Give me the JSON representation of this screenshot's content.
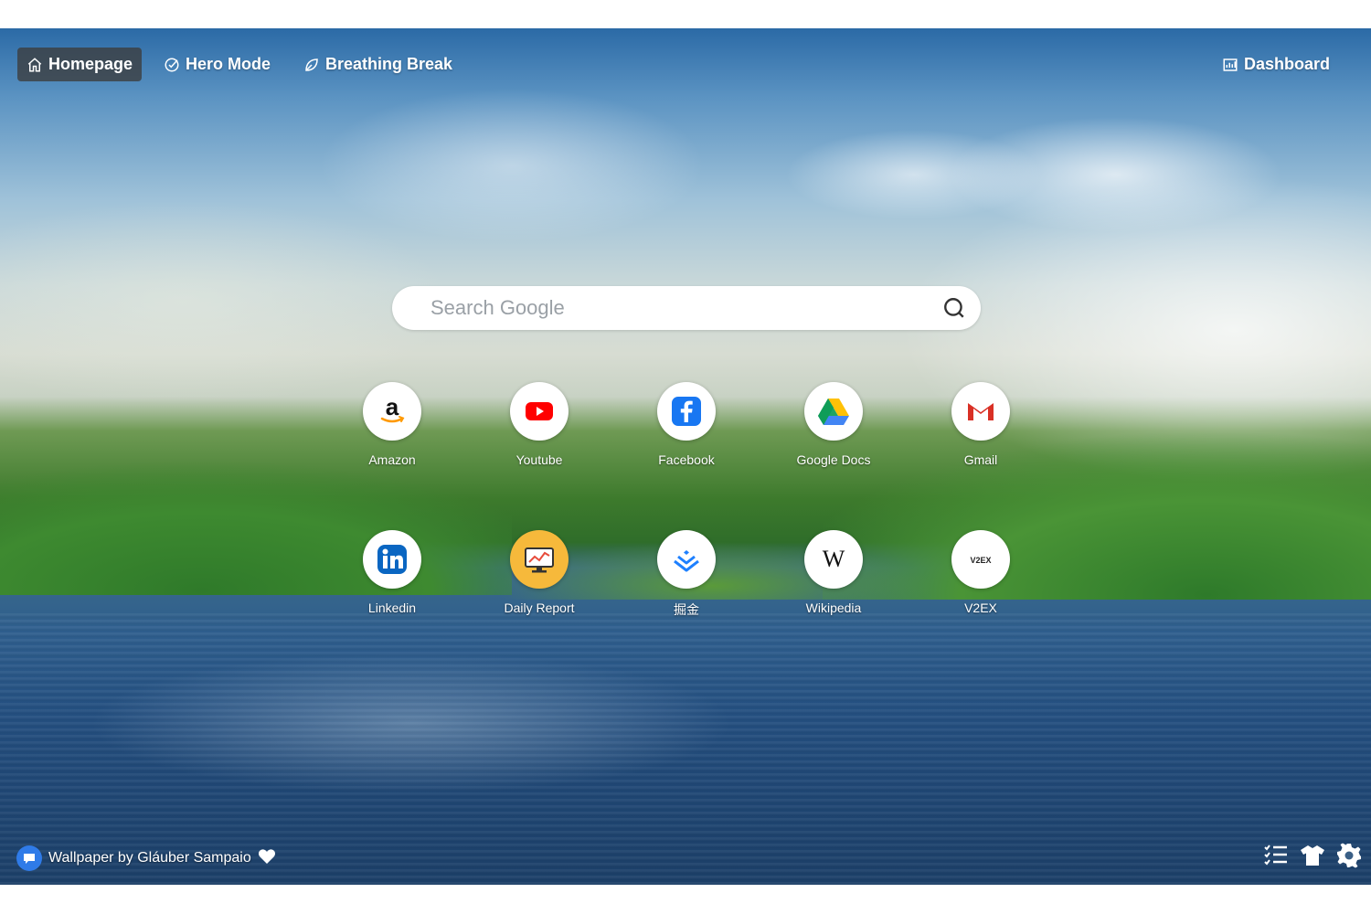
{
  "nav": {
    "left": [
      {
        "label": "Homepage",
        "icon": "home-icon",
        "active": true
      },
      {
        "label": "Hero Mode",
        "icon": "compass-check-icon",
        "active": false
      },
      {
        "label": "Breathing Break",
        "icon": "leaf-icon",
        "active": false
      }
    ],
    "right": {
      "label": "Dashboard",
      "icon": "bar-chart-icon"
    }
  },
  "search": {
    "placeholder": "Search Google",
    "value": ""
  },
  "shortcuts": [
    {
      "label": "Amazon",
      "icon": "amazon-icon"
    },
    {
      "label": "Youtube",
      "icon": "youtube-icon"
    },
    {
      "label": "Facebook",
      "icon": "facebook-icon"
    },
    {
      "label": "Google Docs",
      "icon": "google-drive-icon"
    },
    {
      "label": "Gmail",
      "icon": "gmail-icon"
    },
    {
      "label": "Linkedin",
      "icon": "linkedin-icon"
    },
    {
      "label": "Daily Report",
      "icon": "monitor-chart-icon"
    },
    {
      "label": "掘金",
      "icon": "juejin-icon"
    },
    {
      "label": "Wikipedia",
      "icon": "wikipedia-icon"
    },
    {
      "label": "V2EX",
      "icon": "v2ex-icon"
    }
  ],
  "shortcut_text": {
    "amazon": "a",
    "wikipedia": "W",
    "v2ex": "V2EX"
  },
  "footer": {
    "credit": "Wallpaper by Gláuber Sampaio",
    "tools": [
      "checklist-icon",
      "tshirt-icon",
      "gear-icon"
    ]
  },
  "colors": {
    "youtube": "#ff0000",
    "facebook": "#1877f2",
    "linkedin": "#0a66c2",
    "gmail": "#d93025",
    "credit_badge": "#2f7be8",
    "nav_active_bg": "#3c3c3c"
  }
}
